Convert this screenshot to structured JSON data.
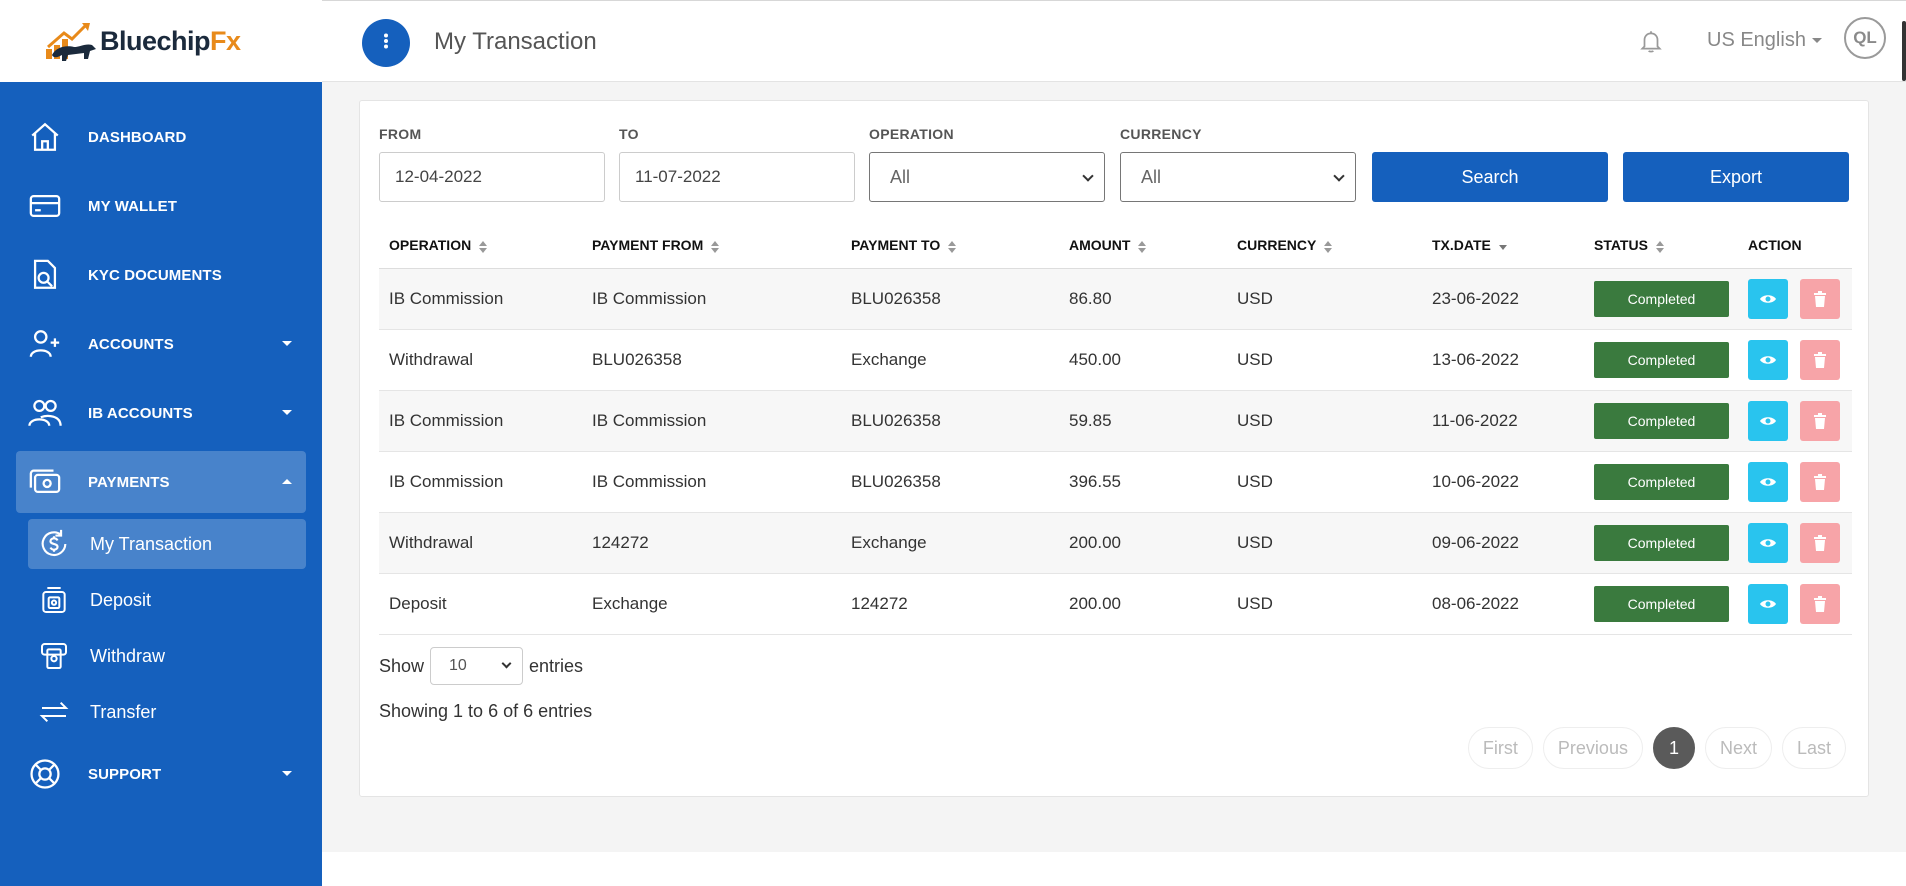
{
  "brand": {
    "name_main": "Bluechip",
    "name_accent": "Fx",
    "accent_color": "#e88a1a",
    "primary_color": "#1560bd"
  },
  "sidebar": {
    "items": [
      {
        "label": "DASHBOARD",
        "icon": "home-icon"
      },
      {
        "label": "MY WALLET",
        "icon": "wallet-icon"
      },
      {
        "label": "KYC DOCUMENTS",
        "icon": "document-search-icon"
      },
      {
        "label": "ACCOUNTS",
        "icon": "user-plus-icon"
      },
      {
        "label": "IB ACCOUNTS",
        "icon": "users-icon"
      },
      {
        "label": "PAYMENTS",
        "icon": "payments-icon"
      },
      {
        "label": "SUPPORT",
        "icon": "lifebuoy-icon"
      }
    ],
    "payments_sub": [
      {
        "label": "My Transaction",
        "icon": "transaction-icon"
      },
      {
        "label": "Deposit",
        "icon": "deposit-icon"
      },
      {
        "label": "Withdraw",
        "icon": "withdraw-icon"
      },
      {
        "label": "Transfer",
        "icon": "transfer-icon"
      }
    ]
  },
  "header": {
    "title": "My Transaction",
    "language": "US English",
    "avatar_initials": "QL"
  },
  "filters": {
    "from_label": "FROM",
    "from_value": "12-04-2022",
    "to_label": "TO",
    "to_value": "11-07-2022",
    "operation_label": "OPERATION",
    "operation_value": "All",
    "currency_label": "CURRENCY",
    "currency_value": "All",
    "search_label": "Search",
    "export_label": "Export"
  },
  "table": {
    "columns": [
      "OPERATION",
      "PAYMENT FROM",
      "PAYMENT TO",
      "AMOUNT",
      "CURRENCY",
      "TX.DATE",
      "STATUS",
      "ACTION"
    ],
    "rows": [
      {
        "operation": "IB Commission",
        "from": "IB Commission",
        "to": "BLU026358",
        "amount": "86.80",
        "currency": "USD",
        "date": "23-06-2022",
        "status": "Completed"
      },
      {
        "operation": "Withdrawal",
        "from": "BLU026358",
        "to": "Exchange",
        "amount": "450.00",
        "currency": "USD",
        "date": "13-06-2022",
        "status": "Completed"
      },
      {
        "operation": "IB Commission",
        "from": "IB Commission",
        "to": "BLU026358",
        "amount": "59.85",
        "currency": "USD",
        "date": "11-06-2022",
        "status": "Completed"
      },
      {
        "operation": "IB Commission",
        "from": "IB Commission",
        "to": "BLU026358",
        "amount": "396.55",
        "currency": "USD",
        "date": "10-06-2022",
        "status": "Completed"
      },
      {
        "operation": "Withdrawal",
        "from": "124272",
        "to": "Exchange",
        "amount": "200.00",
        "currency": "USD",
        "date": "09-06-2022",
        "status": "Completed"
      },
      {
        "operation": "Deposit",
        "from": "Exchange",
        "to": "124272",
        "amount": "200.00",
        "currency": "USD",
        "date": "08-06-2022",
        "status": "Completed"
      }
    ]
  },
  "entries": {
    "show_label": "Show",
    "value": "10",
    "suffix": "entries",
    "summary": "Showing 1 to 6 of 6 entries"
  },
  "pagination": {
    "first": "First",
    "previous": "Previous",
    "current": "1",
    "next": "Next",
    "last": "Last"
  }
}
